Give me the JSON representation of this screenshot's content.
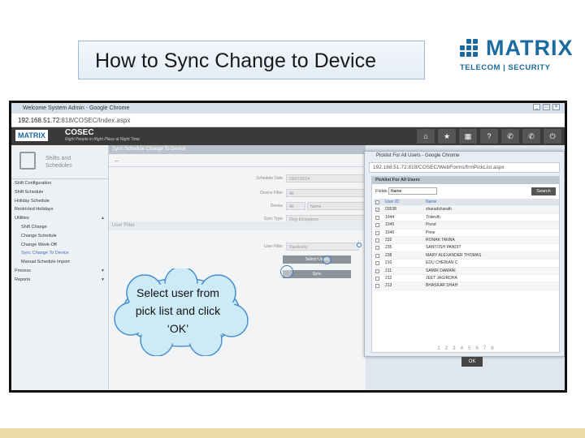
{
  "slide": {
    "title": "How to Sync Change to Device",
    "logo_name": "MATRIX",
    "logo_tagline": "TELECOM | SECURITY",
    "brand_color": "#1b6aa0",
    "callout": "Select user from pick list and click ‘OK’"
  },
  "browser": {
    "title": "Welcome System Admin - Google Chrome",
    "url_host": "192.168.51.72",
    "url_path": ":818/COSEC/Index.aspx"
  },
  "app": {
    "logo": "MATRIX",
    "name": "COSEC",
    "tagline": "Right People in Right Place at Right Time",
    "header_icons": [
      "home-icon",
      "star-icon",
      "table-icon",
      "help-icon",
      "phone-icon",
      "phone-icon",
      "power-icon"
    ],
    "header_glyphs": [
      "⌂",
      "★",
      "▦",
      "?",
      "✆",
      "✆",
      "⏻"
    ]
  },
  "sidebar": {
    "heading_line1": "Shifts and",
    "heading_line2": "Schedules",
    "items": [
      {
        "label": "Shift Configuration",
        "sub": false
      },
      {
        "label": "Shift Schedule",
        "sub": false
      },
      {
        "label": "Holiday Schedule",
        "sub": false
      },
      {
        "label": "Restricted Holidays",
        "sub": false
      },
      {
        "label": "Utilities",
        "sub": false,
        "caret": "▲"
      },
      {
        "label": "Shift Change",
        "sub": true
      },
      {
        "label": "Change Schedule",
        "sub": true
      },
      {
        "label": "Change Week-Off",
        "sub": true
      },
      {
        "label": "Sync Change To Device",
        "sub": true,
        "active": true
      },
      {
        "label": "Manual Schedule Import",
        "sub": true
      },
      {
        "label": "Process",
        "sub": false,
        "caret": "▼"
      },
      {
        "label": "Reports",
        "sub": false,
        "caret": "▼"
      }
    ]
  },
  "content": {
    "panel_title": "Sync Schedule Change To Device",
    "back": "←",
    "fields": [
      {
        "label": "Schedule Date",
        "value": "03/07/2014"
      },
      {
        "label": "Device Filter",
        "value": "All"
      },
      {
        "label": "Device",
        "value": "All"
      },
      {
        "label": "Sync Type",
        "value": "Only Exceptions"
      }
    ],
    "device_name": "Name",
    "user_filter_title": "User Filter",
    "user_filter_label": "User Filter",
    "user_filter_value": "Randomly",
    "select_users_btn": "Select Users",
    "sync_btn": "Sync"
  },
  "popup": {
    "title": "Picklist For All Users - Google Chrome",
    "url": "192.168.51.72:818/COSEC/WebForms/frmPickList.aspx",
    "heading": "Picklist For All Users",
    "field_label": "Fields",
    "field_value": "Name",
    "search_btn": "Search",
    "columns": [
      "User ID",
      "Name"
    ],
    "rows": [
      {
        "id": "03538",
        "name": "sharadsharath",
        "checked": true
      },
      {
        "id": "1044",
        "name": "Tridevth",
        "checked": false
      },
      {
        "id": "1045",
        "name": "Pivod",
        "checked": false
      },
      {
        "id": "1046",
        "name": "Pime",
        "checked": false
      },
      {
        "id": "232",
        "name": "RONAK TANNA",
        "checked": false
      },
      {
        "id": "235",
        "name": "SANTOSH PANDIT",
        "checked": false
      },
      {
        "id": "238",
        "name": "MARY ALEXANDER THOMAS",
        "checked": false
      },
      {
        "id": "210",
        "name": "EDU CHERIAN C",
        "checked": false
      },
      {
        "id": "211",
        "name": "SAMIR DAMANI",
        "checked": false
      },
      {
        "id": "212",
        "name": "JEET JAGIRDHA",
        "checked": false
      },
      {
        "id": "213",
        "name": "BHASKAR SHAH",
        "checked": false
      }
    ],
    "pager": "1 2 3 4 5 6 7 8",
    "ok_btn": "OK"
  }
}
